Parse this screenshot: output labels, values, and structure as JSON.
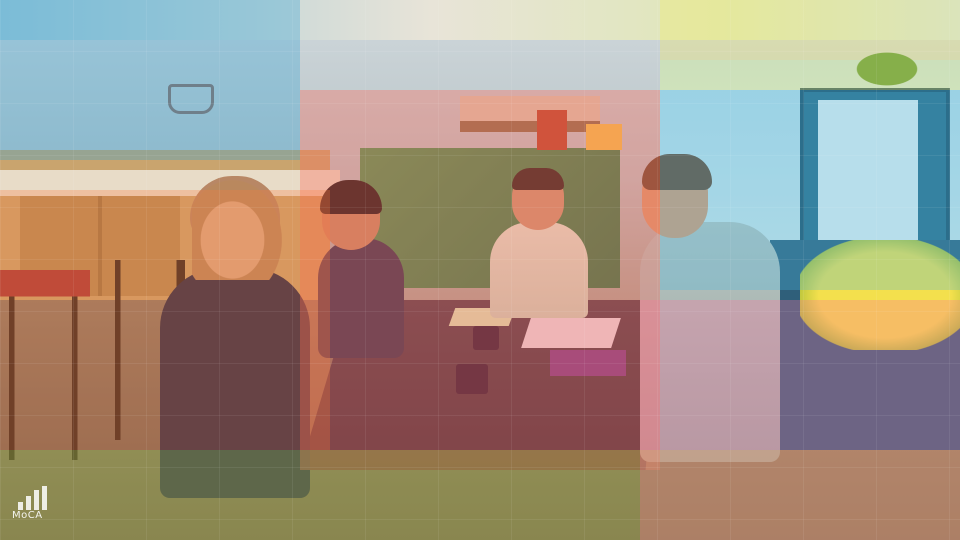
{
  "watermark": {
    "text": "MoCA",
    "icon": "signal-bars-icon"
  },
  "colors": {
    "overlay_red": "#ff6a5a",
    "overlay_blue": "#3aa6d8",
    "overlay_yellow": "#f1ea6a",
    "overlay_green": "#b9d24a",
    "overlay_pink": "#ff6f9a"
  }
}
